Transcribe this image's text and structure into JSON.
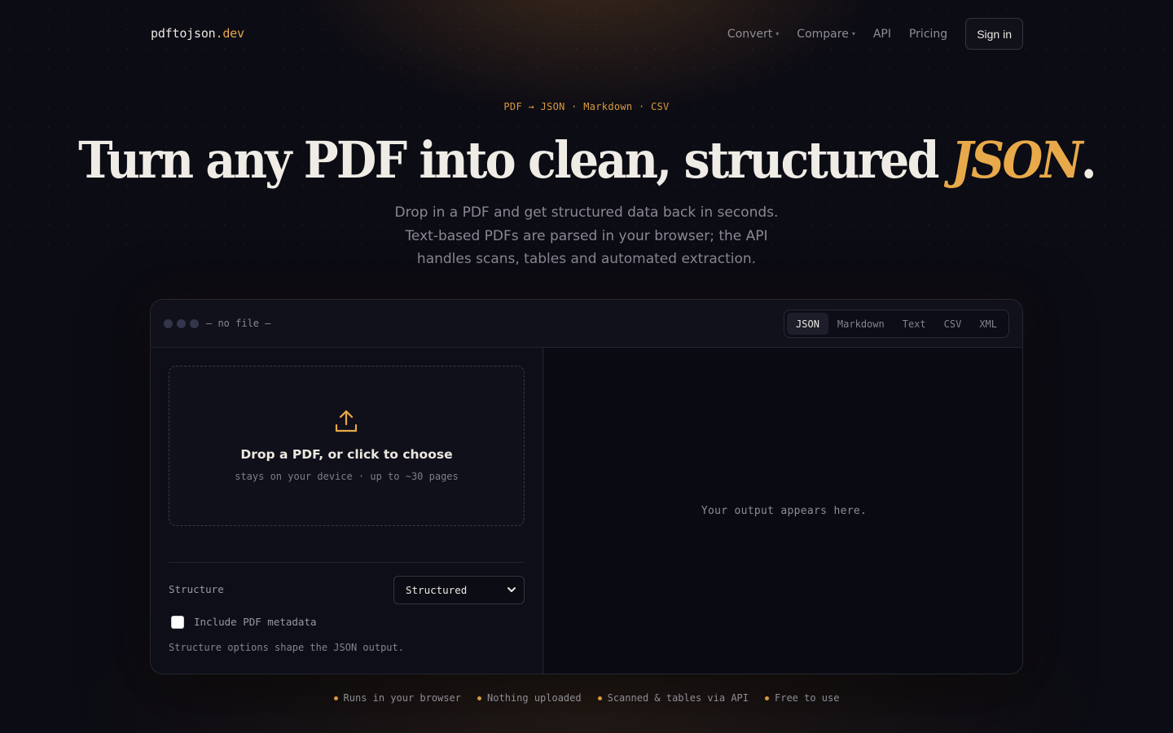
{
  "nav": {
    "logo_name": "pdftojson",
    "logo_tld": ".dev",
    "links": [
      {
        "label": "Convert",
        "caret": "▾"
      },
      {
        "label": "Compare",
        "caret": "▾"
      },
      {
        "label": "API"
      },
      {
        "label": "Pricing"
      }
    ],
    "signin_label": "Sign in"
  },
  "hero": {
    "eyebrow": "PDF → JSON · Markdown · CSV",
    "headline_main": "Turn any PDF into clean, structured ",
    "headline_accent": "JSON",
    "headline_end": ".",
    "lead": "Drop in a PDF and get structured data back in seconds. Text-based PDFs are parsed in your browser; the API handles scans, tables and automated extraction."
  },
  "panel": {
    "filename": "— no file —",
    "tabs": [
      "JSON",
      "Markdown",
      "Text",
      "CSV",
      "XML"
    ],
    "active_tab": "JSON",
    "dropzone": {
      "title": "Drop a PDF, or click to choose",
      "subtitle": "stays on your device · up to ~30 pages",
      "icon": "upload-icon"
    },
    "structure_label": "Structure",
    "structure_value": "Structured",
    "metadata_label": "Include PDF metadata",
    "metadata_checked": false,
    "hint": "Structure options shape the JSON output.",
    "output_placeholder": "Your output appears here."
  },
  "features": [
    "Runs in your browser",
    "Nothing uploaded",
    "Scanned & tables via API",
    "Free to use"
  ],
  "colors": {
    "accent": "#e8a94a",
    "background": "#0c0c14",
    "panel": "#0d0e17"
  }
}
